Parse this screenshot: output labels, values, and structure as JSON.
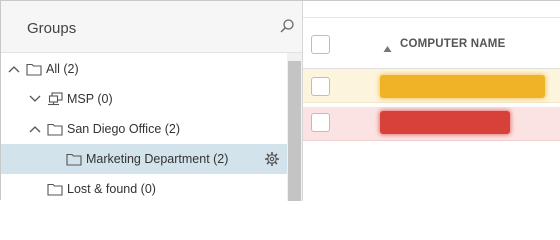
{
  "groups_panel": {
    "title": "Groups",
    "tree": [
      {
        "label": "All (2)",
        "expanded": true,
        "icon": "folder-icon"
      },
      {
        "label": "MSP (0)",
        "expanded": false,
        "icon": "network-icon"
      },
      {
        "label": "San Diego Office (2)",
        "expanded": true,
        "icon": "folder-icon"
      },
      {
        "label": "Marketing Department (2)",
        "selected": true,
        "icon": "folder-icon"
      },
      {
        "label": "Lost & found (0)",
        "icon": "folder-icon"
      }
    ]
  },
  "computers_table": {
    "column_header": "COMPUTER NAME",
    "sort": "ascending",
    "rows": [
      {
        "status": "warning",
        "status_color": "#f0b227",
        "name_redacted": true
      },
      {
        "status": "critical",
        "status_color": "#d8403a",
        "name_redacted": true
      }
    ]
  },
  "colors": {
    "selected_row": "#d2e3ec",
    "warning_row": "#fdf4dd",
    "critical_row": "#fbe3e3"
  }
}
